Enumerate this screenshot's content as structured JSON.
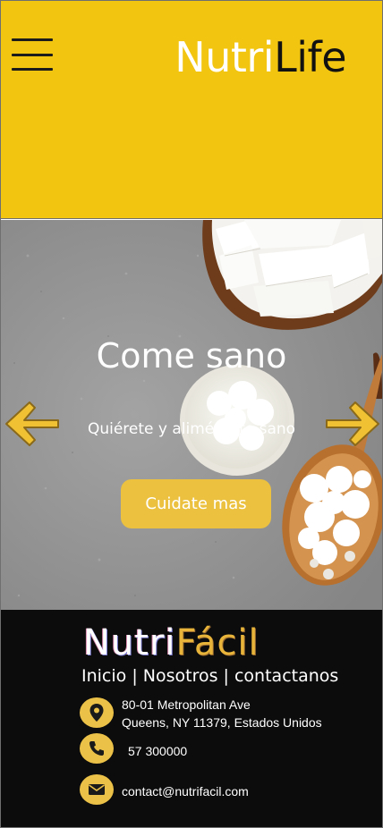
{
  "header": {
    "menu_icon": "hamburger-menu-icon",
    "brand_part1": "Nutri",
    "brand_part2": "Life",
    "background": "#f2c511"
  },
  "hero": {
    "title": "Come sano",
    "subtitle": "Quiérete y aliméntate sano",
    "button_label": "Cuidate mas",
    "prev_icon": "arrow-left-icon",
    "next_icon": "arrow-right-icon",
    "accent": "#ebc13f"
  },
  "footer": {
    "logo_part1": "Nutri",
    "logo_part2": "Fácil",
    "nav": {
      "home": "Inicio",
      "sep1": " | ",
      "about": "Nosotros",
      "sep2": " | ",
      "contact": "contactanos"
    },
    "address_line1": "80-01 Metropolitan Ave",
    "address_line2": "Queens, NY 11379, Estados Unidos",
    "phone": "57 300000",
    "email": "contact@nutrifacil.com",
    "icons": [
      "location-pin-icon",
      "phone-icon",
      "envelope-icon"
    ],
    "background": "#0c0c0c"
  }
}
